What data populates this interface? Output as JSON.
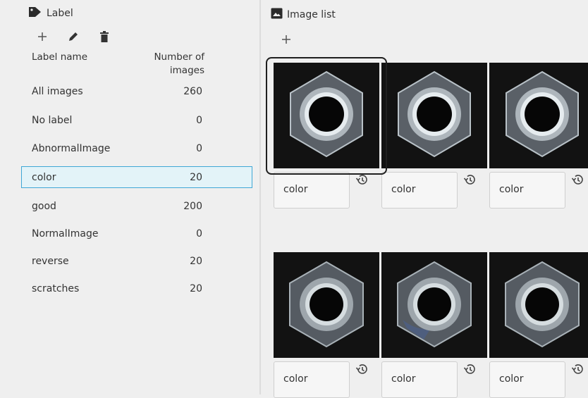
{
  "label_panel": {
    "title": "Label",
    "columns": {
      "name": "Label name",
      "count_line1": "Number of",
      "count_line2": "images"
    },
    "labels": [
      {
        "name": "All images",
        "count": "260"
      },
      {
        "name": "No label",
        "count": "0"
      },
      {
        "name": "AbnormalImage",
        "count": "0"
      },
      {
        "name": "color",
        "count": "20",
        "selected": true
      },
      {
        "name": "good",
        "count": "200"
      },
      {
        "name": "NormalImage",
        "count": "0"
      },
      {
        "name": "reverse",
        "count": "20"
      },
      {
        "name": "scratches",
        "count": "20"
      }
    ]
  },
  "image_panel": {
    "title": "Image list",
    "images": [
      {
        "label": "color",
        "selected": true
      },
      {
        "label": "color"
      },
      {
        "label": "color"
      },
      {
        "label": "color"
      },
      {
        "label": "color"
      },
      {
        "label": "color"
      }
    ]
  },
  "icons": {
    "label_header": "tag-icon",
    "image_header": "image-icon",
    "add": "plus-icon",
    "edit": "pencil-icon",
    "delete": "trash-icon",
    "history": "history-icon"
  },
  "colors": {
    "selection_fill": "#e3f3f8",
    "selection_border": "#3fa7d6"
  }
}
